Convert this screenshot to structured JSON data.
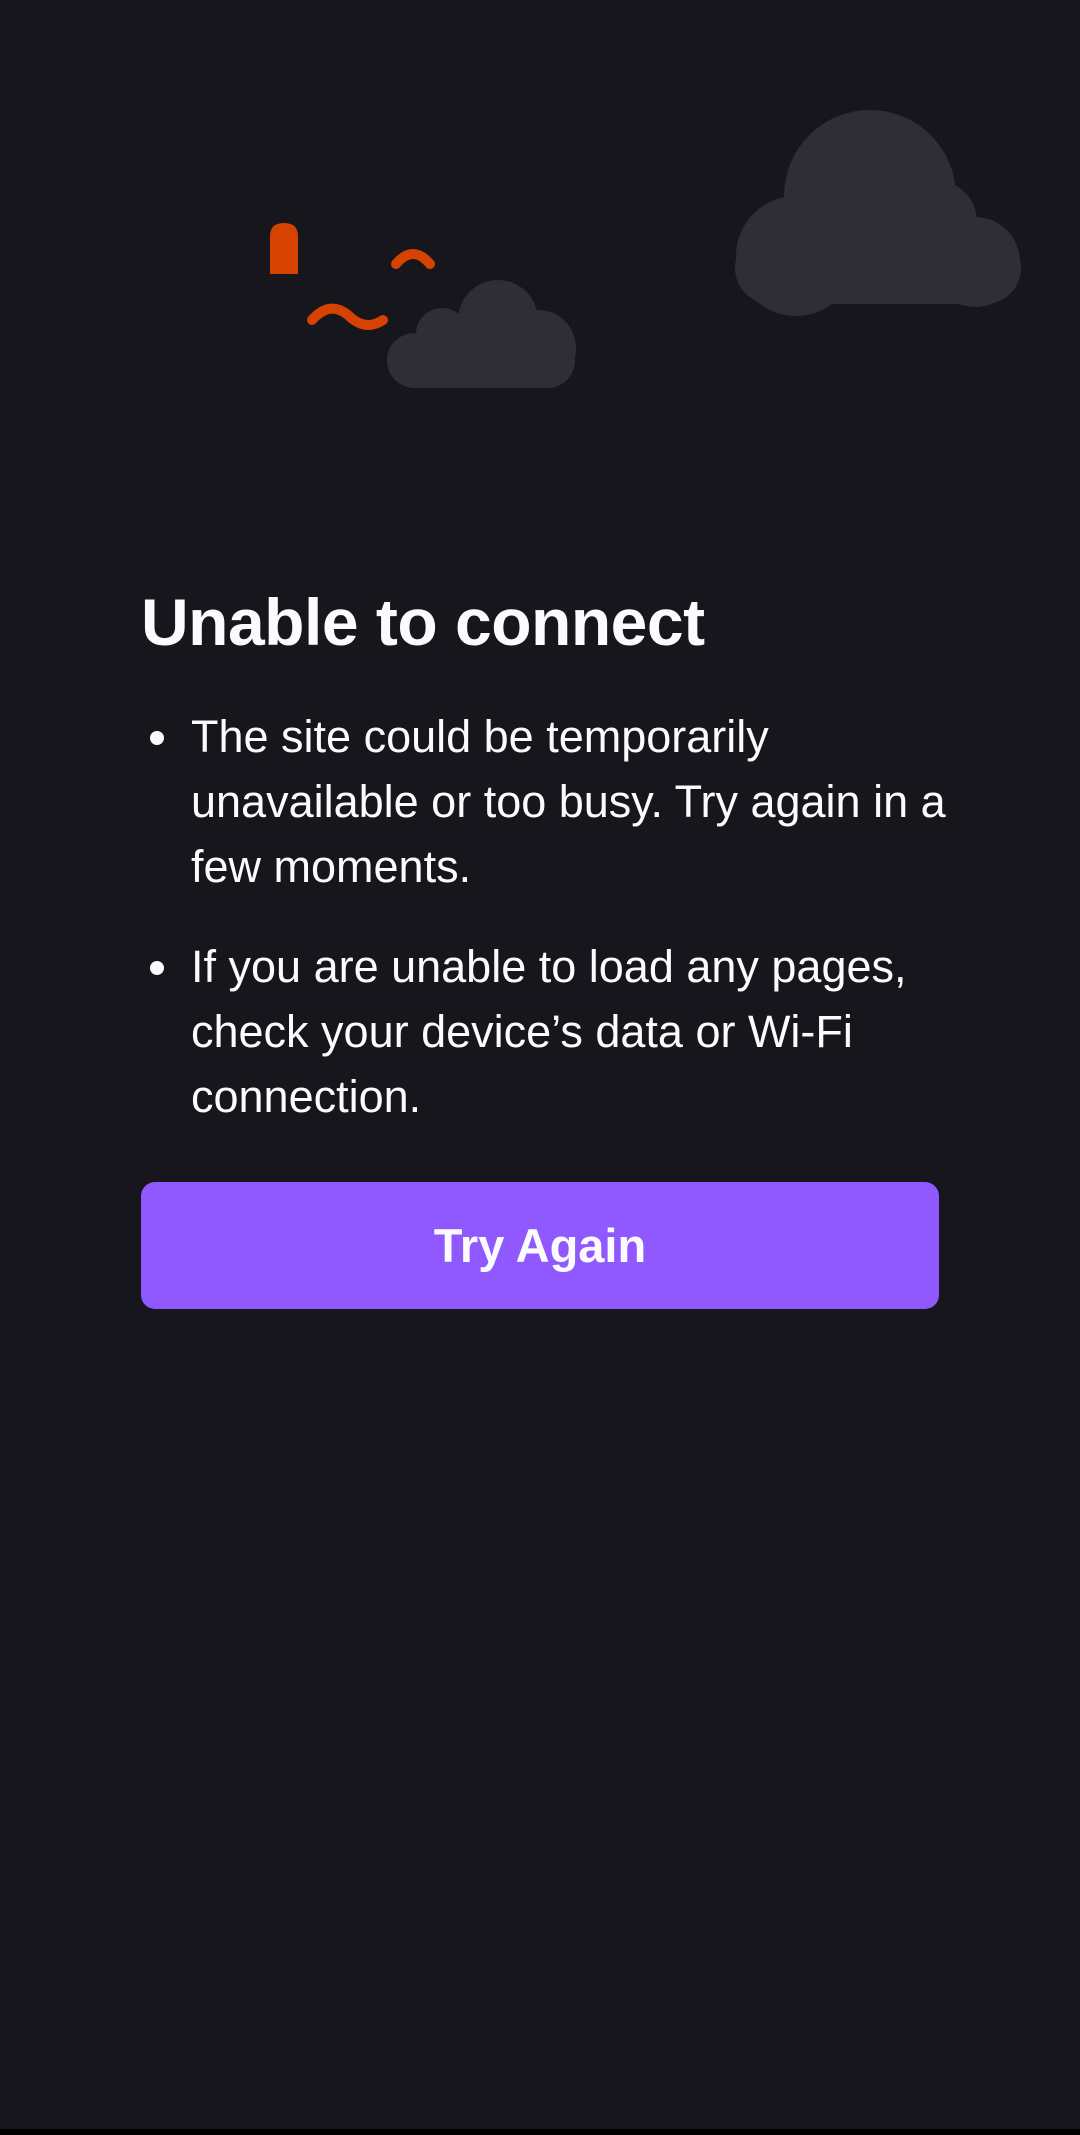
{
  "error": {
    "title": "Unable to connect",
    "bullets": [
      {
        "text": "The site could be temporarily unavailable or too busy. Try again in a few moments."
      },
      {
        "text": "If you are unable to load any pages, check your device’s data or Wi-Fi connection."
      }
    ],
    "button_label": "Try Again"
  },
  "colors": {
    "background": "#17161d",
    "text": "#fbfbfe",
    "accent": "#9059ff",
    "cloud": "#2f2e35",
    "error_mark": "#d64200"
  },
  "icons": [
    "cloud-icon",
    "connection-error-illustration"
  ]
}
